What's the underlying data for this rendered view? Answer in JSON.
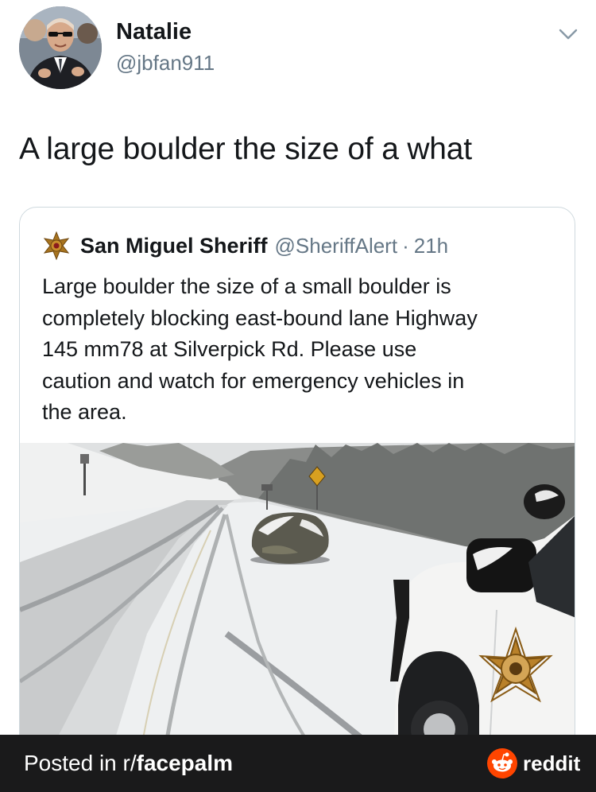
{
  "tweet": {
    "author_name": "Natalie",
    "author_handle": "@jbfan911",
    "text": "A large boulder the size of a what",
    "menu_icon": "chevron-down-icon"
  },
  "quoted_tweet": {
    "author_name": "San Miguel Sheriff",
    "author_handle": "@SheriffAlert",
    "separator": "·",
    "time": "21h",
    "badge_icon": "sheriff-star-icon",
    "text_lines": [
      "Large boulder the size of a small boulder is",
      "completely blocking east-bound lane Highway",
      "145 mm78 at Silverpick Rd. Please use",
      "caution and watch for emergency vehicles in",
      "the area."
    ]
  },
  "footer": {
    "posted_prefix": "Posted in r/",
    "subreddit": "facepalm",
    "brand": "reddit",
    "background": "#1a1a1b",
    "logo_color": "#ff4500"
  },
  "colors": {
    "text_primary": "#14171a",
    "text_secondary": "#657786",
    "card_border": "#cfd9de"
  }
}
